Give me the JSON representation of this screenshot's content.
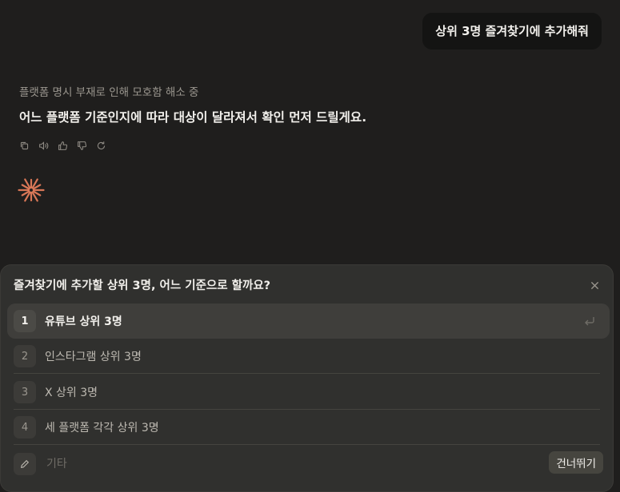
{
  "user_message": "상위 3명 즐겨찾기에 추가해줘",
  "thinking_status": "플랫폼 명시 부재로 인해 모호함 해소 중",
  "assistant_message": "어느 플랫폼 기준인지에 따라 대상이 달라져서 확인 먼저 드릴게요.",
  "message_actions": [
    "copy-icon",
    "speaker-icon",
    "thumbs-up-icon",
    "thumbs-down-icon",
    "retry-icon"
  ],
  "accent_color": "#d97757",
  "question_panel": {
    "title": "즐겨찾기에 추가할 상위 3명, 어느 기준으로 할까요?",
    "options": [
      {
        "number": "1",
        "label": "유튜브 상위 3명"
      },
      {
        "number": "2",
        "label": "인스타그램 상위 3명"
      },
      {
        "number": "3",
        "label": "X 상위 3명"
      },
      {
        "number": "4",
        "label": "세 플랫폼 각각 상위 3명"
      }
    ],
    "selected_index": 0,
    "other_placeholder": "기타",
    "skip_label": "건너뛰기"
  }
}
